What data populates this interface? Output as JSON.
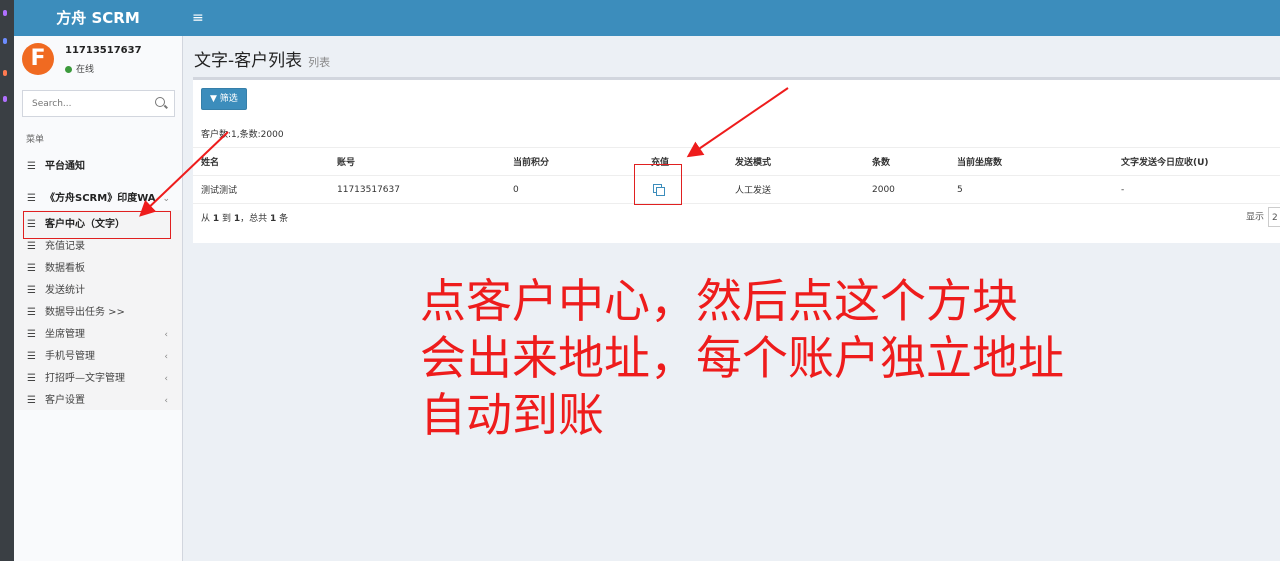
{
  "app": {
    "logo": "方舟 SCRM",
    "menu_toggle": "≡"
  },
  "user": {
    "avatar_letter": "F",
    "name": "11713517637",
    "status": "在线"
  },
  "search": {
    "placeholder": "Search..."
  },
  "menu": {
    "header": "菜单",
    "items": [
      {
        "label": "平台通知",
        "bold": true
      },
      {
        "label": "《方舟SCRM》印度WA",
        "bold": true
      },
      {
        "label": "客户中心（文字）",
        "bold": true,
        "active": true
      },
      {
        "label": "充值记录"
      },
      {
        "label": "数据看板"
      },
      {
        "label": "发送统计"
      },
      {
        "label": "数据导出任务 >>"
      },
      {
        "label": "坐席管理",
        "chevron": "‹"
      },
      {
        "label": "手机号管理",
        "chevron": "‹"
      },
      {
        "label": "打招呼—文字管理",
        "chevron": "‹"
      },
      {
        "label": "客户设置",
        "chevron": "‹"
      }
    ],
    "expand_icon": "⌄"
  },
  "page": {
    "title": "文字-客户列表",
    "subtitle": "列表"
  },
  "toolbar": {
    "filter_label": "筛选"
  },
  "summary": "客户数:1,条数:2000",
  "table": {
    "columns": [
      "姓名",
      "账号",
      "当前积分",
      "充值",
      "发送模式",
      "条数",
      "当前坐席数",
      "文字发送今日应收(U)"
    ],
    "rows": [
      {
        "name": "测试测试",
        "account": "11713517637",
        "points": "0",
        "mode": "人工发送",
        "count": "2000",
        "seats": "5",
        "today": "-"
      }
    ]
  },
  "pagination": {
    "prefix": "从 ",
    "from": "1",
    "mid1": " 到 ",
    "to": "1",
    "mid2": "，总共 ",
    "total": "1",
    "suffix": " 条",
    "show_label": "显示",
    "page_size": "2"
  },
  "annotation": {
    "line1": "点客户中心，然后点这个方块",
    "line2": "会出来地址，每个账户独立地址",
    "line3": "自动到账"
  },
  "colors": {
    "primary": "#3c8dbc",
    "annotation_red": "#ee1c1c",
    "avatar_orange": "#f06a21"
  }
}
